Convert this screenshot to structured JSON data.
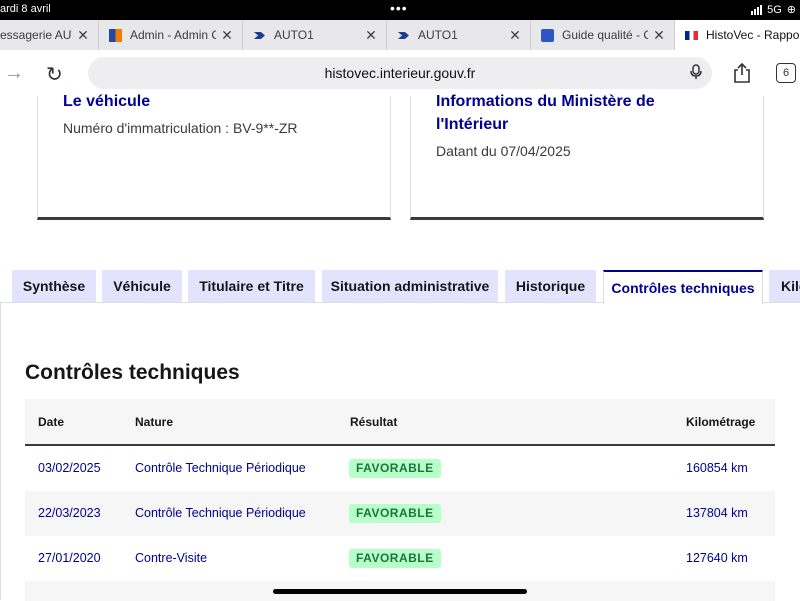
{
  "status_bar": {
    "time": "ardi 8 avril",
    "network": "5G"
  },
  "browser_tabs": [
    {
      "title": "essagerie AUT",
      "icon": "mail-icon"
    },
    {
      "title": "Admin - Admin C",
      "icon": "admin-favicon"
    },
    {
      "title": "AUTO1",
      "icon": "auto1-favicon"
    },
    {
      "title": "AUTO1",
      "icon": "auto1-favicon"
    },
    {
      "title": "Guide qualité - C",
      "icon": "doc-favicon"
    },
    {
      "title": "HistoVec - Rappo",
      "icon": "french-flag-icon"
    }
  ],
  "url_bar": {
    "url": "histovec.interieur.gouv.fr",
    "tab_count": "6"
  },
  "cards": {
    "vehicle": {
      "title": "Le véhicule",
      "text": "Numéro d'immatriculation : BV-9**-ZR"
    },
    "ministry": {
      "title_line1": "Informations du Ministère de",
      "title_line2": "l'Intérieur",
      "text": "Datant du 07/04/2025"
    }
  },
  "page_tabs": [
    "Synthèse",
    "Véhicule",
    "Titulaire et Titre",
    "Situation administrative",
    "Historique",
    "Contrôles techniques",
    "Kilo"
  ],
  "active_page_tab": "Contrôles techniques",
  "section_title": "Contrôles techniques",
  "table": {
    "headers": [
      "Date",
      "Nature",
      "Résultat",
      "Kilométrage"
    ],
    "rows": [
      {
        "date": "03/02/2025",
        "nature": "Contrôle Technique Périodique",
        "result": "FAVORABLE",
        "km": "160854 km"
      },
      {
        "date": "22/03/2023",
        "nature": "Contrôle Technique Périodique",
        "result": "FAVORABLE",
        "km": "137804 km"
      },
      {
        "date": "27/01/2020",
        "nature": "Contre-Visite",
        "result": "FAVORABLE",
        "km": "127640 km"
      }
    ]
  },
  "colors": {
    "primary": "#000091",
    "tab_bg": "#e3e3fd",
    "badge_bg": "#b8fec9",
    "badge_text": "#18753c"
  }
}
